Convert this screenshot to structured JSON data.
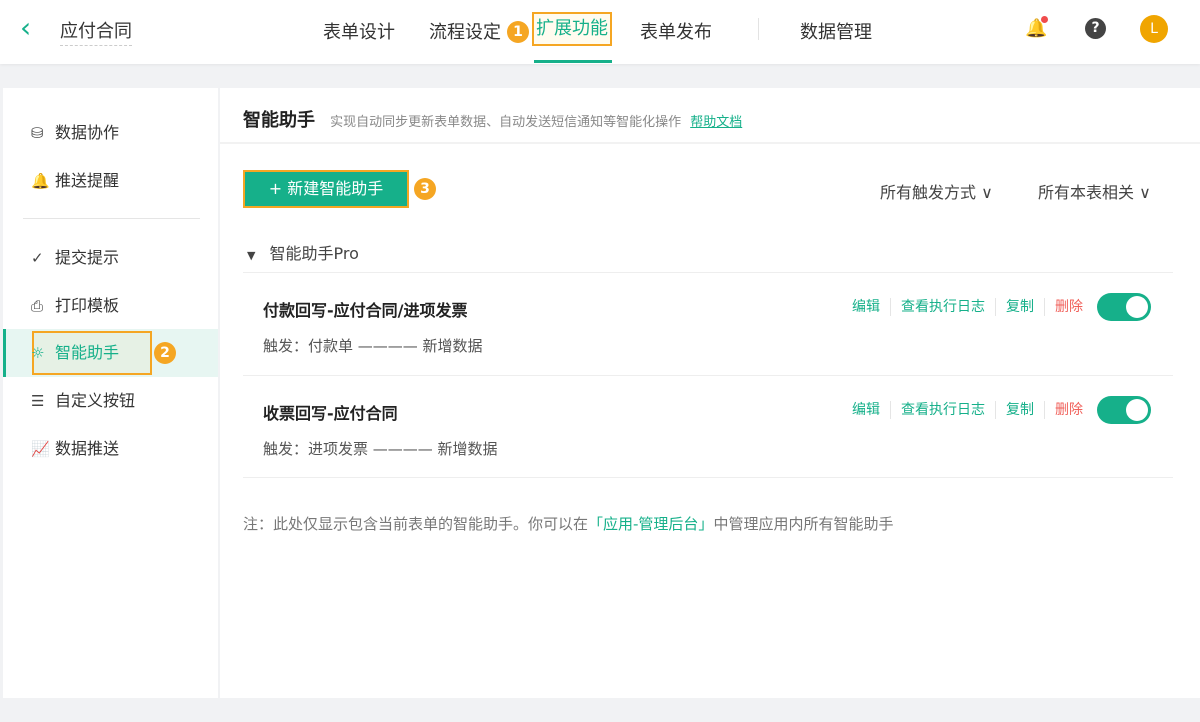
{
  "header": {
    "back_icon": "chevron-left-icon",
    "title": "应付合同",
    "tabs": [
      {
        "label": "表单设计"
      },
      {
        "label": "流程设定"
      },
      {
        "label": "扩展功能",
        "active": true
      },
      {
        "label": "表单发布"
      },
      {
        "label": "数据管理"
      }
    ],
    "avatar": "L"
  },
  "badges": [
    "1",
    "2",
    "3"
  ],
  "sidebar": {
    "items": [
      {
        "label": "数据协作",
        "icon": "⛁"
      },
      {
        "label": "推送提醒",
        "icon": "🔔"
      },
      {
        "label": "提交提示",
        "icon": "✓"
      },
      {
        "label": "打印模板",
        "icon": "⎙"
      },
      {
        "label": "智能助手",
        "icon": "☼"
      },
      {
        "label": "自定义按钮",
        "icon": "☰"
      },
      {
        "label": "数据推送",
        "icon": "📈"
      }
    ]
  },
  "main": {
    "title": "智能助手",
    "desc": "实现自动同步更新表单数据、自动发送短信通知等智能化操作",
    "help": "帮助文档",
    "new_button": "+ 新建智能助手",
    "filters": [
      "所有触发方式 ∨",
      "所有本表相关 ∨"
    ],
    "group": "智能助手Pro",
    "rows": [
      {
        "name": "付款回写-应付合同/进项发票",
        "trigger": "触发：付款单 ———— 新增数据",
        "enabled": true
      },
      {
        "name": "收票回写-应付合同",
        "trigger": "触发：进项发票 ———— 新增数据",
        "enabled": true
      }
    ],
    "actions": {
      "edit": "编辑",
      "log": "查看执行日志",
      "copy": "复制",
      "delete": "删除"
    },
    "note_pre": "注：此处仅显示包含当前表单的智能助手。你可以在",
    "note_link": "「应用-管理后台」",
    "note_post": "中管理应用内所有智能助手"
  }
}
